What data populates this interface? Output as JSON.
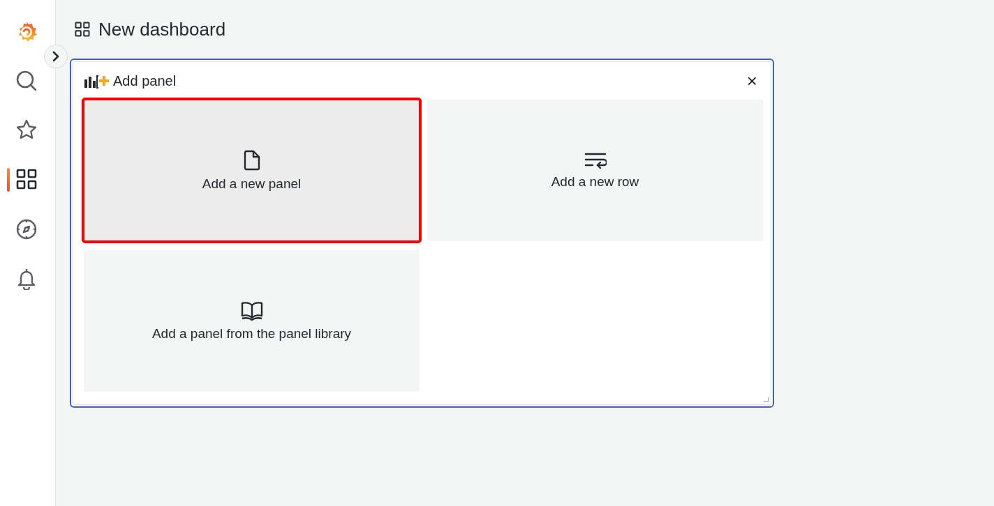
{
  "sidebar": {
    "items": [
      {
        "kind": "search",
        "selected": false
      },
      {
        "kind": "star",
        "selected": false
      },
      {
        "kind": "dashboards",
        "selected": true
      },
      {
        "kind": "explore",
        "selected": false
      },
      {
        "kind": "alerting",
        "selected": false
      }
    ]
  },
  "header": {
    "title": "New dashboard"
  },
  "panel": {
    "title": "Add panel",
    "close": "×",
    "options": [
      {
        "kind": "file",
        "label": "Add a new panel",
        "highlighted": true
      },
      {
        "kind": "row",
        "label": "Add a new row",
        "highlighted": false
      },
      {
        "kind": "library",
        "label": "Add a panel from the panel library",
        "highlighted": false
      }
    ]
  }
}
